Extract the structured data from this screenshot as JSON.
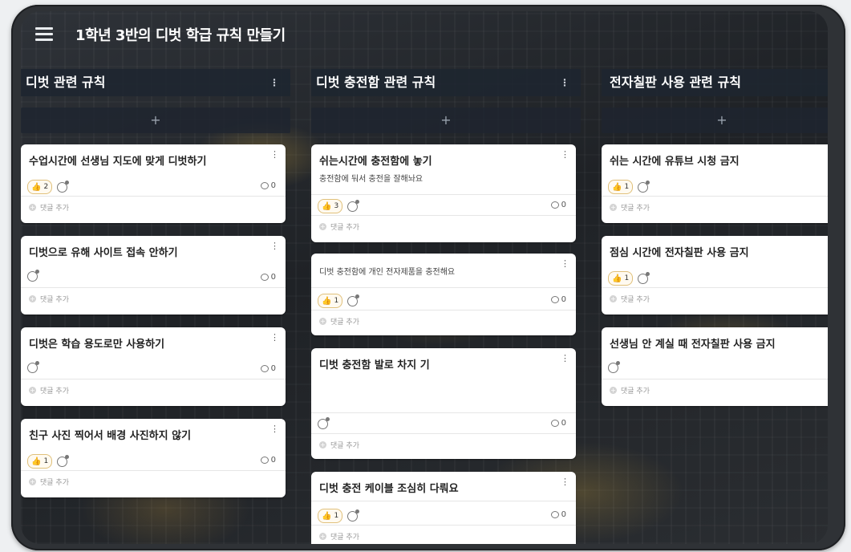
{
  "board": {
    "title": "1학년 3반의 디벗 학급 규칙 만들기"
  },
  "add_symbol": "+",
  "kebab": "⋮",
  "add_comment_label": "댓글 추가",
  "columns": [
    {
      "title": "디벗 관련 규칙",
      "cards": [
        {
          "title": "수업시간에 선생님 지도에 맞게 디벗하기",
          "body": "",
          "likes": "2",
          "comments": "0"
        },
        {
          "title": "디벗으로 유해 사이트 접속 안하기",
          "body": "",
          "likes": "",
          "comments": "0"
        },
        {
          "title": "디벗은 학습 용도로만 사용하기",
          "body": "",
          "likes": "",
          "comments": "0"
        },
        {
          "title": "친구 사진 찍어서 배경 사진하지 않기",
          "body": "",
          "likes": "1",
          "comments": "0"
        }
      ]
    },
    {
      "title": "디벗 충전함 관련 규칙",
      "cards": [
        {
          "title": "쉬는시간에 충전함에 놓기",
          "body": "충전함에 둬서 충전을 잘해놔요",
          "likes": "3",
          "comments": "0"
        },
        {
          "title": "",
          "body": "디벗 충전함에 개인 전자제품을 충전해요",
          "likes": "1",
          "comments": "0"
        },
        {
          "title": "디벗 충전함 발로 차지  기",
          "body": "",
          "likes": "",
          "comments": "0"
        },
        {
          "title": "디벗 충전 케이블 조심히 다뤄요",
          "body": "",
          "likes": "1",
          "comments": "0"
        }
      ]
    },
    {
      "title": "전자칠판 사용 관련 규칙",
      "cards": [
        {
          "title": "쉬는 시간에 유튜브 시청 금지",
          "body": "",
          "likes": "1",
          "comments": ""
        },
        {
          "title": "점심 시간에 전자칠판 사용 금지",
          "body": "",
          "likes": "1",
          "comments": ""
        },
        {
          "title": "선생님 안 계실 때 전자칠판 사용 금지",
          "body": "",
          "likes": "",
          "comments": ""
        }
      ]
    }
  ]
}
